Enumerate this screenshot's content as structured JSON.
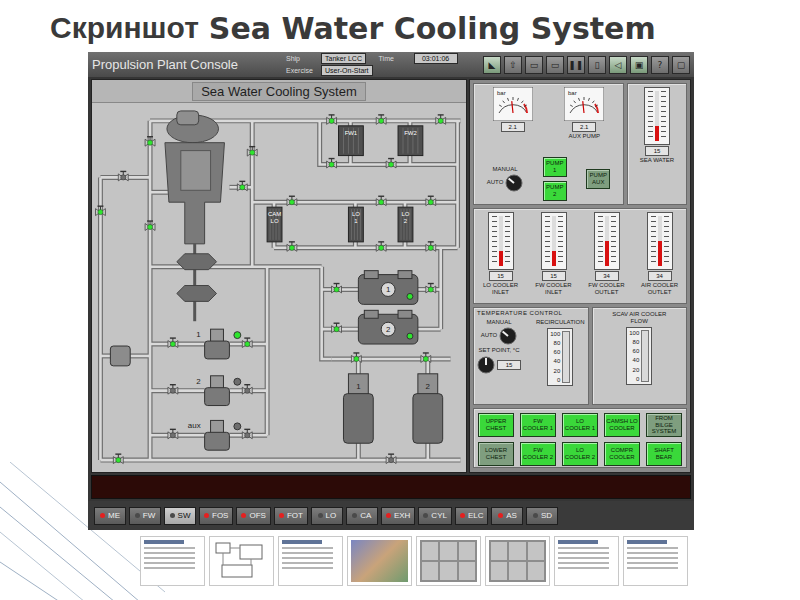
{
  "slide_title": {
    "prefix": "Скриншот",
    "main": "Sea Water Cooling System"
  },
  "console": {
    "title": "Propulsion Plant Console",
    "fields": [
      {
        "label": "Ship",
        "value": "Tanker LCC"
      },
      {
        "label": "Time",
        "value": "03:01:06"
      },
      {
        "label": "Exercise",
        "value": "User-On-Start"
      }
    ]
  },
  "toolbar": [
    {
      "glyph": "◣",
      "active": true
    },
    {
      "glyph": "⇧",
      "active": false
    },
    {
      "glyph": "▭",
      "active": false
    },
    {
      "glyph": "▭",
      "active": false
    },
    {
      "glyph": "❚❚",
      "active": false
    },
    {
      "glyph": "▯",
      "active": false
    },
    {
      "glyph": "◁",
      "active": true
    },
    {
      "glyph": "▣",
      "active": true
    },
    {
      "glyph": "?",
      "active": false
    },
    {
      "glyph": "▢",
      "active": false
    }
  ],
  "diagram": {
    "title": "Sea Water Cooling System",
    "coolers": [
      {
        "label": "FW1"
      },
      {
        "label": "FW2"
      },
      {
        "label": "CAM LO"
      },
      {
        "label": "LO 1"
      },
      {
        "label": "LO 2"
      }
    ],
    "compressors": [
      {
        "label": "1",
        "running": true
      },
      {
        "label": "2",
        "running": true
      }
    ],
    "pumps": [
      {
        "label": "1",
        "running": true
      },
      {
        "label": "2",
        "running": false
      },
      {
        "label": "aux",
        "running": false
      }
    ],
    "sea_chests": [
      {
        "label": "1"
      },
      {
        "label": "2"
      }
    ],
    "valves": [
      {
        "open": true
      },
      {
        "open": true
      },
      {
        "open": false
      },
      {
        "open": true
      },
      {
        "open": true
      },
      {
        "open": true
      },
      {
        "open": true
      },
      {
        "open": true
      },
      {
        "open": true
      },
      {
        "open": true
      },
      {
        "open": true
      },
      {
        "open": true
      },
      {
        "open": true
      },
      {
        "open": true
      },
      {
        "open": true
      },
      {
        "open": true
      },
      {
        "open": true
      },
      {
        "open": true
      },
      {
        "open": true
      },
      {
        "open": true
      },
      {
        "open": true
      },
      {
        "open": false
      },
      {
        "open": false
      },
      {
        "open": true
      },
      {
        "open": false
      },
      {
        "open": false
      },
      {
        "open": true
      },
      {
        "open": true
      },
      {
        "open": false
      },
      {
        "open": true
      }
    ]
  },
  "gauges": [
    {
      "unit": "bar",
      "reading": "2.1",
      "level": 0.45,
      "caption": ""
    },
    {
      "unit": "bar",
      "reading": "2.1",
      "level": 0.45,
      "caption": "AUX PUMP"
    }
  ],
  "pump_mode": {
    "manual_label": "MANUAL",
    "auto_label": "AUTO",
    "auto": true
  },
  "pump_buttons": [
    {
      "label": "PUMP 1",
      "on": true
    },
    {
      "label": "PUMP 2",
      "on": true
    },
    {
      "label": "PUMP AUX",
      "on": false
    }
  ],
  "sea_water": {
    "label": "SEA WATER",
    "reading": "15",
    "level": 0.3
  },
  "thermometers": [
    {
      "label": "LO COOLER INLET",
      "reading": "15",
      "level": 0.3
    },
    {
      "label": "FW COOLER INLET",
      "reading": "15",
      "level": 0.3
    },
    {
      "label": "FW COOLER OUTLET",
      "reading": "34",
      "level": 0.5
    },
    {
      "label": "AIR COOLER OUTLET",
      "reading": "34",
      "level": 0.5
    }
  ],
  "temperature_control": {
    "title": "TEMPERATURE CONTROL",
    "manual_label": "MANUAL",
    "auto_label": "AUTO",
    "auto": true,
    "set_point_label": "SET POINT, °C",
    "set_point": "15",
    "recirculation": {
      "label": "RECIRCULATION",
      "level": 0.0,
      "scale": [
        "100",
        "80",
        "60",
        "40",
        "20",
        "0"
      ]
    },
    "scav": {
      "label": "SCAV AIR COOLER FLOW",
      "level": 0.0,
      "scale": [
        "100",
        "80",
        "60",
        "40",
        "20",
        "0"
      ]
    }
  },
  "valve_buttons": [
    {
      "label": "UPPER CHEST",
      "open": true
    },
    {
      "label": "FW COOLER 1",
      "open": true
    },
    {
      "label": "LO COOLER 1",
      "open": true
    },
    {
      "label": "CAMSH LO COOLER",
      "open": true
    },
    {
      "label": "FROM BILGE SYSTEM",
      "open": false
    },
    {
      "label": "LOWER CHEST",
      "open": false
    },
    {
      "label": "FW COOLER 2",
      "open": true
    },
    {
      "label": "LO COOLER 2",
      "open": true
    },
    {
      "label": "COMPR COOLER",
      "open": true
    },
    {
      "label": "SHAFT BEAR",
      "open": true
    }
  ],
  "tabs": [
    {
      "label": "ME",
      "selected": false,
      "alarm": true
    },
    {
      "label": "FW",
      "selected": false,
      "alarm": false
    },
    {
      "label": "SW",
      "selected": true,
      "alarm": false
    },
    {
      "label": "FOS",
      "selected": false,
      "alarm": true
    },
    {
      "label": "OFS",
      "selected": false,
      "alarm": true
    },
    {
      "label": "FOT",
      "selected": false,
      "alarm": true
    },
    {
      "label": "LO",
      "selected": false,
      "alarm": false
    },
    {
      "label": "CA",
      "selected": false,
      "alarm": false
    },
    {
      "label": "EXH",
      "selected": false,
      "alarm": true
    },
    {
      "label": "CYL",
      "selected": false,
      "alarm": false
    },
    {
      "label": "ELC",
      "selected": false,
      "alarm": true
    },
    {
      "label": "AS",
      "selected": false,
      "alarm": true
    },
    {
      "label": "SD",
      "selected": false,
      "alarm": false
    }
  ],
  "thumbnails": [
    {
      "kind": "text"
    },
    {
      "kind": "diagram"
    },
    {
      "kind": "text"
    },
    {
      "kind": "photo"
    },
    {
      "kind": "screen"
    },
    {
      "kind": "screen"
    },
    {
      "kind": "text"
    },
    {
      "kind": "text"
    }
  ]
}
